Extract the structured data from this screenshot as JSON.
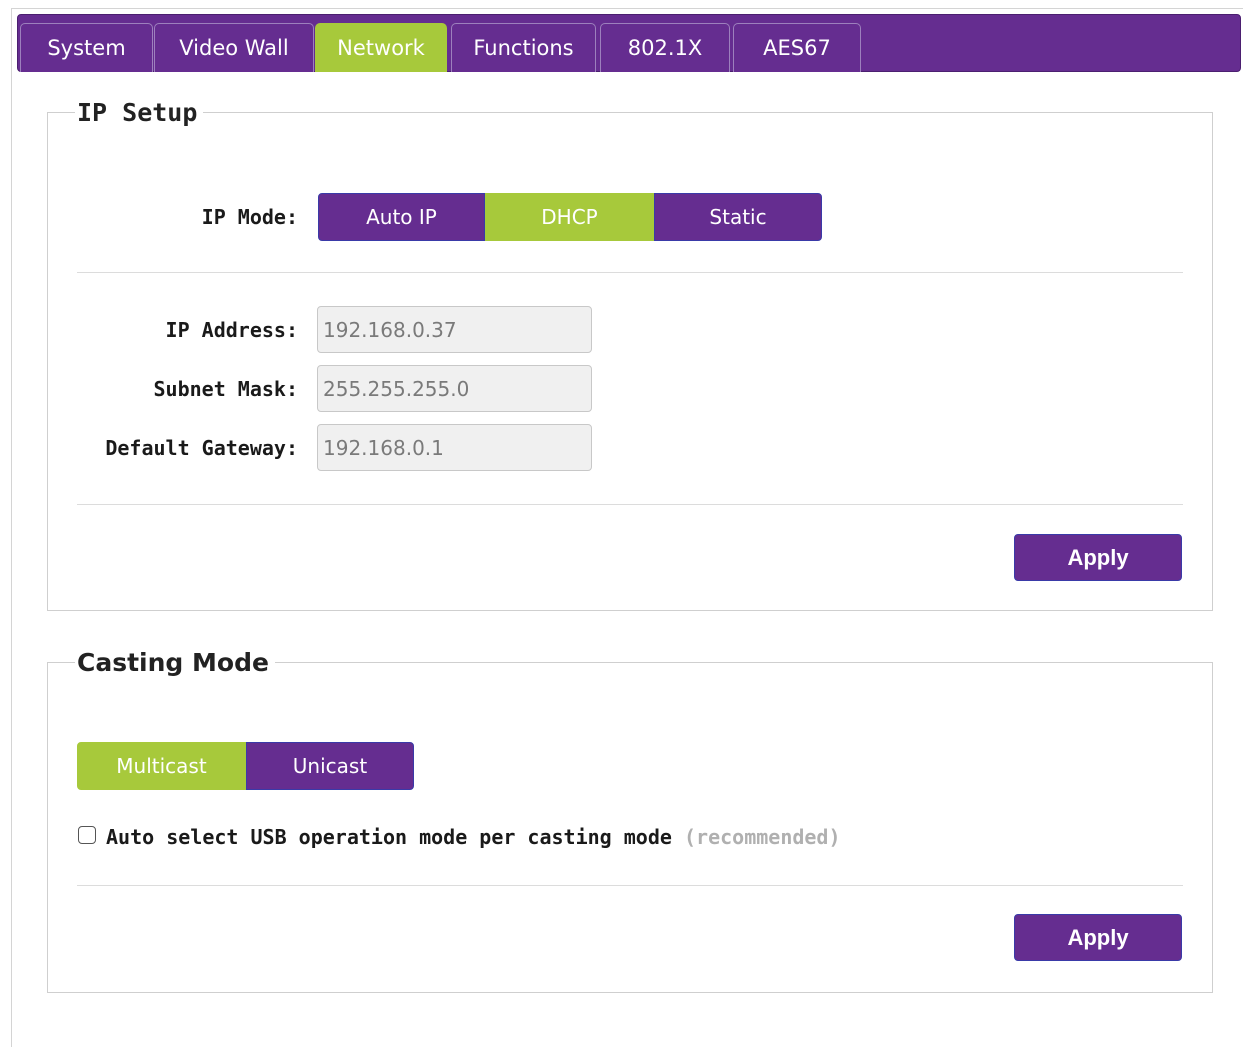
{
  "colors": {
    "primary_purple": "#652d90",
    "active_green": "#a7c93b"
  },
  "tabs": [
    {
      "label": "System",
      "active": false
    },
    {
      "label": "Video Wall",
      "active": false
    },
    {
      "label": "Network",
      "active": true
    },
    {
      "label": "Functions",
      "active": false
    },
    {
      "label": "802.1X",
      "active": false
    },
    {
      "label": "AES67",
      "active": false
    }
  ],
  "ip_setup": {
    "title": "IP Setup",
    "ip_mode_label": "IP Mode:",
    "ip_mode_options": [
      {
        "label": "Auto IP",
        "selected": false
      },
      {
        "label": "DHCP",
        "selected": true
      },
      {
        "label": "Static",
        "selected": false
      }
    ],
    "ip_address_label": "IP Address:",
    "ip_address_value": "192.168.0.37",
    "subnet_mask_label": "Subnet Mask:",
    "subnet_mask_value": "255.255.255.0",
    "gateway_label": "Default Gateway:",
    "gateway_value": "192.168.0.1",
    "apply_label": "Apply"
  },
  "casting_mode": {
    "title": "Casting Mode",
    "options": [
      {
        "label": "Multicast",
        "selected": true
      },
      {
        "label": "Unicast",
        "selected": false
      }
    ],
    "usb_checkbox_label": "Auto select USB operation mode per casting mode",
    "usb_checkbox_note": "(recommended)",
    "usb_checkbox_checked": false,
    "apply_label": "Apply"
  }
}
